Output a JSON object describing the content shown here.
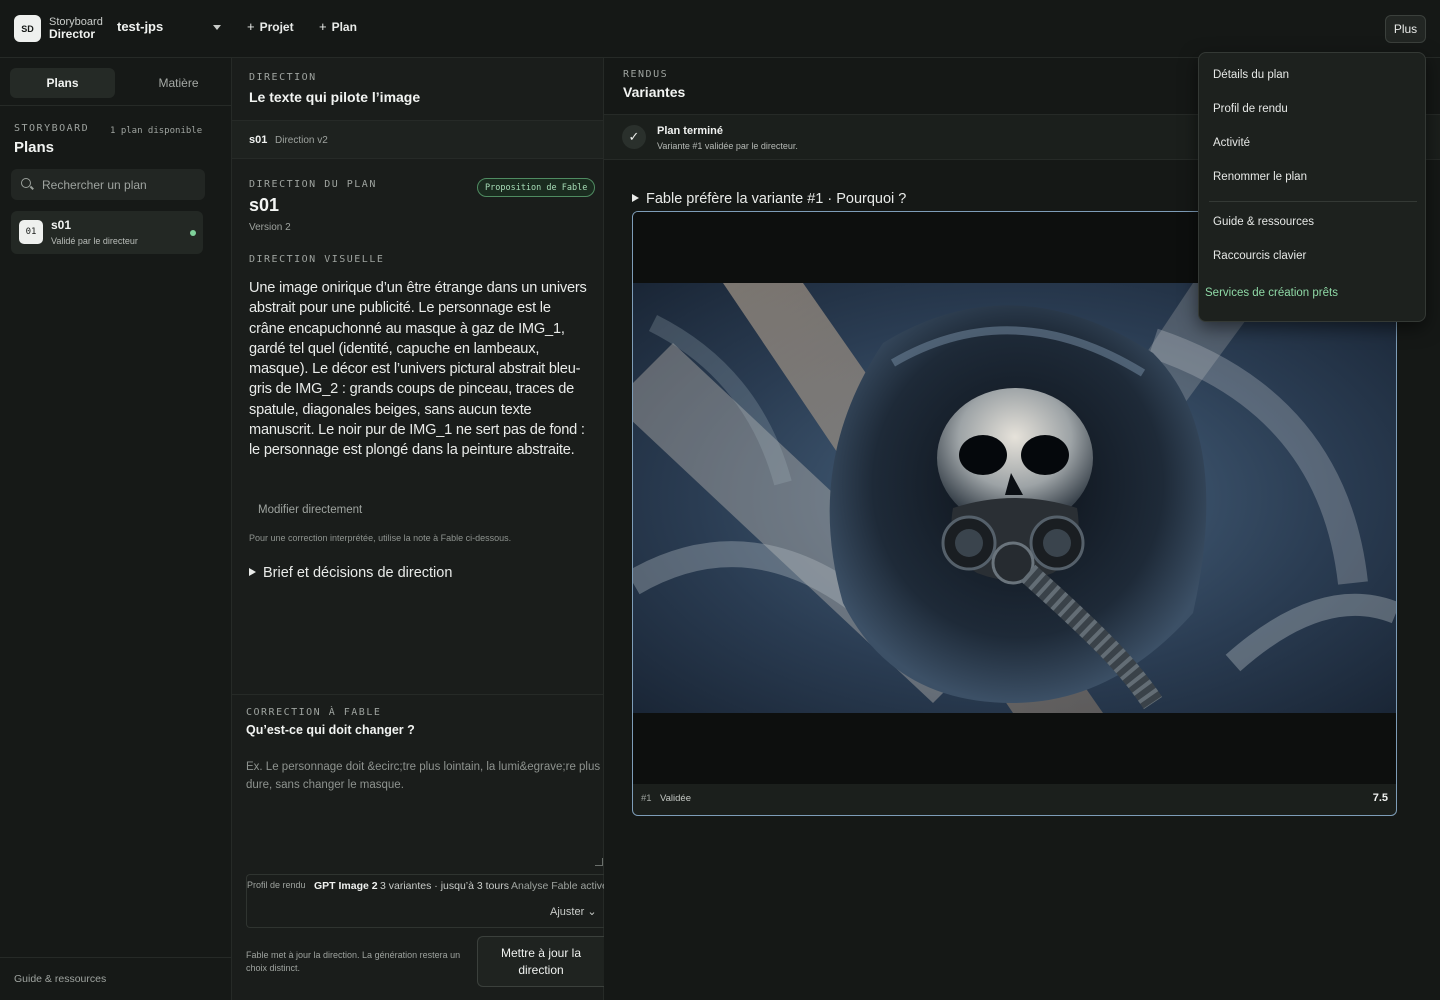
{
  "topbar": {
    "logo": "SD",
    "brand_line1": "Storyboard",
    "brand_line2": "Director",
    "project": "test-jps",
    "add_project": "Projet",
    "add_plan": "Plan",
    "more": "Plus"
  },
  "sidebar": {
    "tabs": [
      "Plans",
      "Matière"
    ],
    "overline": "STORYBOARD",
    "count": "1 plan disponible",
    "title": "Plans",
    "search_placeholder": "Rechercher un plan",
    "items": [
      {
        "num": "01",
        "name": "s01",
        "status": "Validé par le directeur",
        "status_color": "#7fd19a"
      }
    ],
    "footer": "Guide & ressources"
  },
  "direction": {
    "overline": "DIRECTION",
    "title": "Le texte qui pilote l’image",
    "strip_id": "s01",
    "strip_version": "Direction v2",
    "plan_overline": "DIRECTION DU PLAN",
    "badge": "Proposition de Fable",
    "plan_name": "s01",
    "version": "Version 2",
    "visual_overline": "DIRECTION VISUELLE",
    "visual_text": "Une image onirique d’un être étrange dans un univers abstrait pour une publicité. Le personnage est le crâne encapuchonné au masque à gaz de IMG_1, gardé tel quel (identité, capuche en lambeaux, masque). Le décor est l’univers pictural abstrait bleu-gris de IMG_2 : grands coups de pinceau, traces de spatule, diagonales beiges, sans aucun texte manuscrit. Le noir pur de IMG_1 ne sert pas de fond : le personnage est plongé dans la peinture abstraite.",
    "edit_link": "Modifier directement",
    "edit_note": "Pour une correction interprétée, utilise la note à Fable ci-dessous.",
    "brief": "Brief et décisions de direction"
  },
  "correction": {
    "overline": "CORRECTION À FABLE",
    "title": "Qu’est-ce qui doit changer ?",
    "placeholder": "Ex. Le personnage doit &ecirc;tre plus lointain, la lumi&egrave;re plus dure, sans changer le masque.",
    "profile_label": "Profil de rendu",
    "profile_model": "GPT Image 2",
    "profile_variants": "3 variantes · jusqu’à 3 tours",
    "profile_analysis": "Analyse Fable active",
    "adjust": "Ajuster",
    "footer_note": "Fable met à jour la direction. La génération restera un choix distinct.",
    "submit": "Mettre à jour la direction"
  },
  "renders": {
    "overline": "RENDUS",
    "title": "Variantes",
    "status_title": "Plan terminé",
    "status_sub": "Variante #1 validée par le directeur.",
    "why": "Fable préfère la variante #1 · Pourquoi ?",
    "variant_num": "#1",
    "variant_status": "Validée",
    "variant_score": "7.5"
  },
  "menu": {
    "items": [
      "Détails du plan",
      "Profil de rendu",
      "Activité",
      "Renommer le plan",
      "Guide & ressources",
      "Raccourcis clavier",
      "Services de création prêts"
    ],
    "accent": "#8fd9a6"
  }
}
